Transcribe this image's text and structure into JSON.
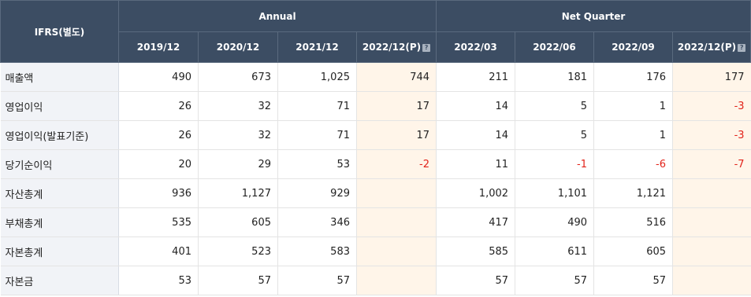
{
  "header": {
    "corner_label": "IFRS(별도)",
    "group_annual": "Annual",
    "group_quarter": "Net Quarter",
    "annual_periods": [
      "2019/12",
      "2020/12",
      "2021/12",
      "2022/12(P)"
    ],
    "quarter_periods": [
      "2022/03",
      "2022/06",
      "2022/09",
      "2022/12(P)"
    ],
    "help_glyph": "?"
  },
  "rows": [
    {
      "label": "매출액",
      "values": [
        "490",
        "673",
        "1,025",
        "744",
        "211",
        "181",
        "176",
        "177"
      ]
    },
    {
      "label": "영업이익",
      "values": [
        "26",
        "32",
        "71",
        "17",
        "14",
        "5",
        "1",
        "-3"
      ]
    },
    {
      "label": "영업이익(발표기준)",
      "values": [
        "26",
        "32",
        "71",
        "17",
        "14",
        "5",
        "1",
        "-3"
      ]
    },
    {
      "label": "당기순이익",
      "values": [
        "20",
        "29",
        "53",
        "-2",
        "11",
        "-1",
        "-6",
        "-7"
      ]
    },
    {
      "label": "자산총계",
      "values": [
        "936",
        "1,127",
        "929",
        "",
        "1,002",
        "1,101",
        "1,121",
        ""
      ]
    },
    {
      "label": "부채총계",
      "values": [
        "535",
        "605",
        "346",
        "",
        "417",
        "490",
        "516",
        ""
      ]
    },
    {
      "label": "자본총계",
      "values": [
        "401",
        "523",
        "583",
        "",
        "585",
        "611",
        "605",
        ""
      ]
    },
    {
      "label": "자본금",
      "values": [
        "53",
        "57",
        "57",
        "",
        "57",
        "57",
        "57",
        ""
      ]
    }
  ],
  "colors": {
    "header_bg": "#3c4d63",
    "estimate_bg": "#fff5e9",
    "negative_text": "#e2231a",
    "label_bg": "#f1f3f7"
  }
}
